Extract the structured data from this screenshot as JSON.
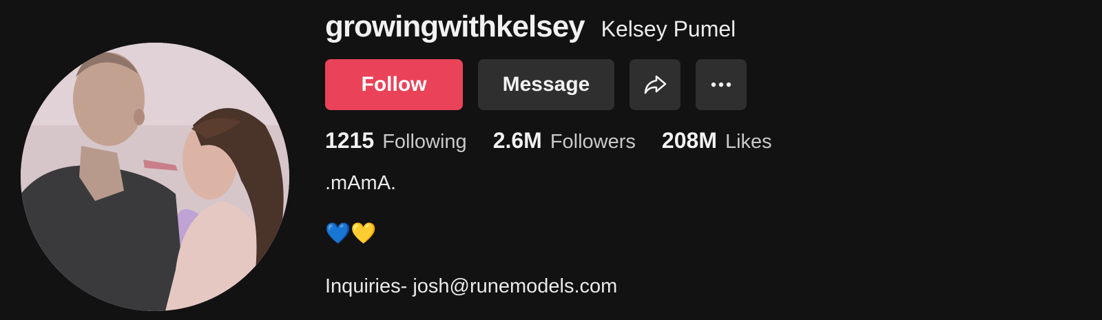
{
  "profile": {
    "username": "growingwithkelsey",
    "display_name": "Kelsey Pumel"
  },
  "actions": {
    "follow_label": "Follow",
    "message_label": "Message",
    "share_icon": "share-arrow-icon",
    "more_icon": "more-dots-icon"
  },
  "stats": [
    {
      "value": "1215",
      "label": "Following"
    },
    {
      "value": "2.6M",
      "label": "Followers"
    },
    {
      "value": "208M",
      "label": "Likes"
    }
  ],
  "bio": {
    "line1": ".mAmA.",
    "line2": "💙💛",
    "line3": "Inquiries- josh@runemodels.com"
  },
  "colors": {
    "background": "#121212",
    "follow": "#ea4359",
    "secondary_button": "#2f2f2f"
  }
}
